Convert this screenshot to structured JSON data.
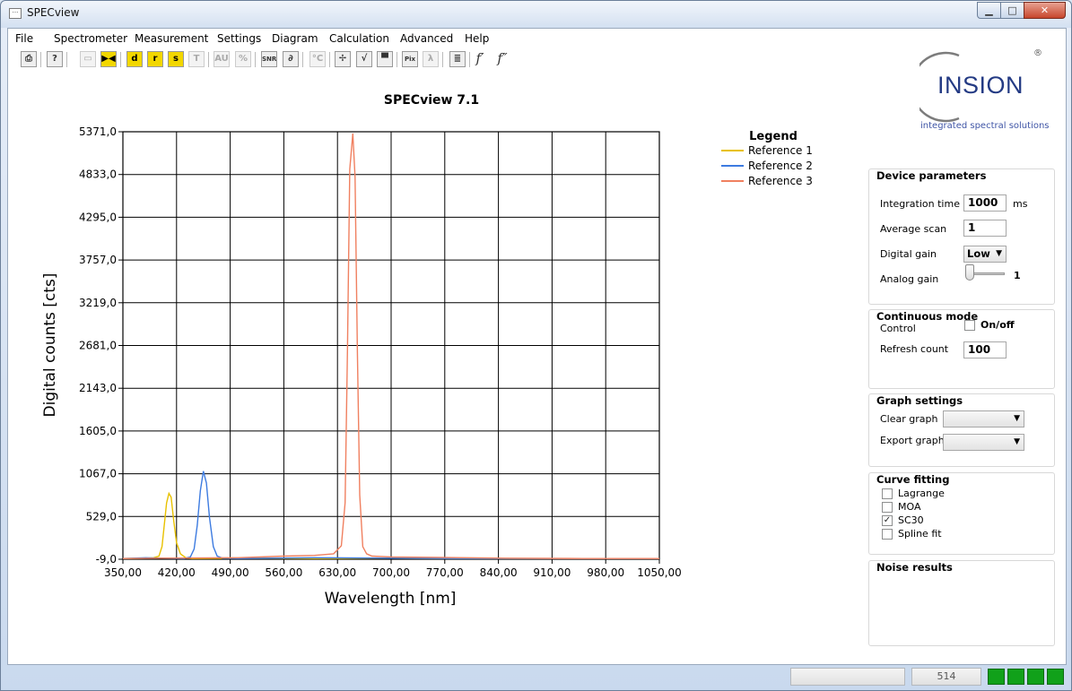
{
  "window": {
    "title": "SPECview",
    "icon": "app-icon",
    "minimize_glyph": "▁",
    "maximize_glyph": "□",
    "close_glyph": "✕"
  },
  "menu": [
    "File",
    "Spectrometer",
    "Measurement",
    "Settings",
    "Diagram",
    "Calculation",
    "Advanced",
    "Help"
  ],
  "toolbar": [
    {
      "icon": "print-icon",
      "glyph": "⎙"
    },
    {
      "icon": "help-icon",
      "glyph": "?"
    },
    {
      "icon": "ruler-icon",
      "glyph": "▭"
    },
    {
      "icon": "bw-icon",
      "glyph": "▶◀"
    },
    {
      "icon": "dark-icon",
      "glyph": "d"
    },
    {
      "icon": "reference-icon",
      "glyph": "r"
    },
    {
      "icon": "sample-icon",
      "glyph": "s"
    },
    {
      "icon": "transmission-icon",
      "glyph": "T"
    },
    {
      "icon": "au-icon",
      "glyph": "AU"
    },
    {
      "icon": "percent-icon",
      "glyph": "%"
    },
    {
      "icon": "snr-icon",
      "glyph": "SNR"
    },
    {
      "icon": "scope-icon",
      "glyph": "∂"
    },
    {
      "icon": "temperature-icon",
      "glyph": "°C"
    },
    {
      "icon": "calibration-icon",
      "glyph": "✢"
    },
    {
      "icon": "curve-icon",
      "glyph": "√"
    },
    {
      "icon": "window-icon",
      "glyph": "▀"
    },
    {
      "icon": "pixel-icon",
      "glyph": "Pix"
    },
    {
      "icon": "lambda-icon",
      "glyph": "λ"
    },
    {
      "icon": "document-icon",
      "glyph": "≣"
    },
    {
      "icon": "first-derivative-icon",
      "glyph": "f′"
    },
    {
      "icon": "second-derivative-icon",
      "glyph": "f″"
    }
  ],
  "logo": {
    "name": "INSION",
    "tagline": "integrated spectral solutions",
    "reg": "®"
  },
  "chart_data": {
    "type": "line",
    "title": "SPECview 7.1",
    "xlabel": "Wavelength [nm]",
    "ylabel": "Digital counts [cts]",
    "xlim": [
      350,
      1050
    ],
    "ylim": [
      -9,
      5371
    ],
    "xticks": [
      "350,00",
      "420,00",
      "490,00",
      "560,00",
      "630,00",
      "700,00",
      "770,00",
      "840,00",
      "910,00",
      "980,00",
      "1050,00"
    ],
    "yticks": [
      "-9,0",
      "529,0",
      "1067,0",
      "1605,0",
      "2143,0",
      "2681,0",
      "3219,0",
      "3757,0",
      "4295,0",
      "4833,0",
      "5371,0"
    ],
    "grid": true,
    "legend": {
      "title": "Legend",
      "placement": "right"
    },
    "series": [
      {
        "name": "Reference 1",
        "color": "#e8c100",
        "x": [
          350,
          380,
          390,
          397,
          401,
          404,
          407,
          410,
          413,
          416,
          420,
          425,
          432,
          440,
          500,
          600,
          700,
          800,
          900,
          1050
        ],
        "y": [
          0,
          5,
          10,
          30,
          150,
          420,
          700,
          820,
          770,
          500,
          200,
          60,
          10,
          0,
          5,
          0,
          5,
          0,
          0,
          0
        ]
      },
      {
        "name": "Reference 2",
        "color": "#3d7be0",
        "x": [
          350,
          380,
          400,
          430,
          438,
          443,
          447,
          451,
          455,
          459,
          463,
          468,
          473,
          480,
          500,
          600,
          700,
          800,
          900,
          1050
        ],
        "y": [
          0,
          10,
          5,
          0,
          20,
          120,
          420,
          850,
          1100,
          950,
          520,
          150,
          30,
          5,
          0,
          10,
          5,
          0,
          0,
          0
        ]
      },
      {
        "name": "Reference 3",
        "color": "#f08060",
        "x": [
          350,
          400,
          500,
          560,
          600,
          625,
          635,
          640,
          643,
          646,
          650,
          653,
          656,
          659,
          663,
          668,
          675,
          700,
          760,
          850,
          950,
          1050
        ],
        "y": [
          0,
          5,
          10,
          30,
          40,
          60,
          160,
          700,
          2600,
          4900,
          5350,
          4800,
          2600,
          800,
          150,
          60,
          30,
          20,
          15,
          5,
          0,
          0
        ]
      }
    ]
  },
  "device_parameters": {
    "title": "Device parameters",
    "integration_time_label": "Integration time",
    "integration_time": "1000",
    "integration_unit": "ms",
    "average_scan_label": "Average scan",
    "average_scan": "1",
    "digital_gain_label": "Digital gain",
    "digital_gain": "Low",
    "analog_gain_label": "Analog gain",
    "analog_gain": "1"
  },
  "continuous_mode": {
    "title": "Continuous mode",
    "control_label": "Control",
    "onoff_label": "On/off",
    "refresh_count_label": "Refresh count",
    "refresh_count": "100"
  },
  "graph_settings": {
    "title": "Graph settings",
    "clear_graph_label": "Clear graph",
    "export_graph_label": "Export graph"
  },
  "curve_fitting": {
    "title": "Curve fitting",
    "options": [
      {
        "label": "Lagrange",
        "checked": false
      },
      {
        "label": "MOA",
        "checked": false
      },
      {
        "label": "SC30",
        "checked": true
      },
      {
        "label": "Spline fit",
        "checked": false
      }
    ]
  },
  "noise_results": {
    "title": "Noise results"
  },
  "status": {
    "value": "514",
    "led_color": "#11a11a"
  }
}
